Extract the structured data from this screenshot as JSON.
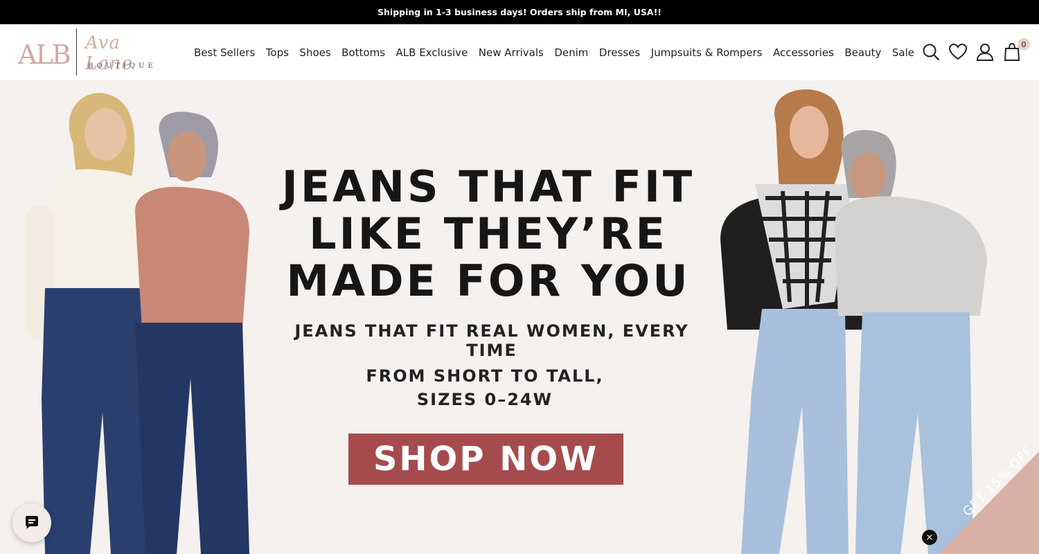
{
  "announcement": "Shipping in 1-3 business days! Orders ship from MI, USA!!",
  "logo": {
    "mark": "ALB",
    "script": "Ava Lane",
    "sub": "BOUTIQUE"
  },
  "nav": {
    "items": [
      "Best Sellers",
      "Tops",
      "Shoes",
      "Bottoms",
      "ALB Exclusive",
      "New Arrivals",
      "Denim",
      "Dresses",
      "Jumpsuits & Rompers",
      "Accessories",
      "Beauty",
      "Sale"
    ]
  },
  "header_icons": {
    "search": "search-icon",
    "wishlist": "heart-icon",
    "account": "user-icon",
    "cart": "shopping-bag-icon",
    "cart_count": "0"
  },
  "hero": {
    "headline_1": "JEANS THAT FIT",
    "headline_2": "LIKE THEY’RE",
    "headline_3": "MADE FOR YOU",
    "subheading": "JEANS THAT FIT REAL WOMEN, EVERY TIME",
    "detail_1": "FROM SHORT TO TALL,",
    "detail_2": "SIZES 0–24W",
    "cta": "SHOP NOW"
  },
  "chat": {
    "icon": "chat-bubble-icon"
  },
  "promo": {
    "label": "GET 15% OFF",
    "close": "×"
  },
  "colors": {
    "announcement_bg": "#000000",
    "hero_bg": "#f4f1ee",
    "cta_bg": "#a54b4e",
    "logo_accent": "#d2a9a0",
    "promo_bg": "#d9b0a6"
  }
}
